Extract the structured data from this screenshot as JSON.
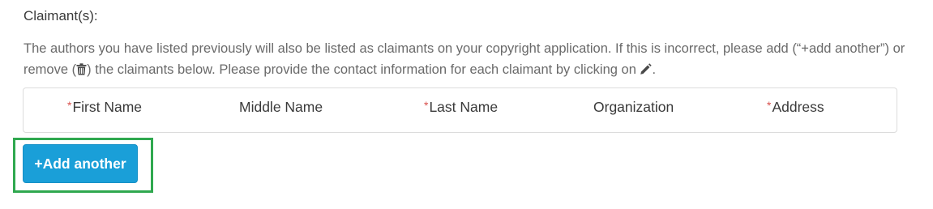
{
  "section": {
    "title": "Claimant(s):",
    "desc_part1": "The authors you have listed previously will also be listed as claimants on your copyright application. If this is incorrect, please add (“+add another”) or remove (",
    "desc_part2": ") the claimants below. Please provide the contact information for each claimant by clicking on ",
    "desc_part3": "."
  },
  "table": {
    "required_marker": "*",
    "columns": [
      {
        "label": "First Name",
        "required": true
      },
      {
        "label": "Middle Name",
        "required": false
      },
      {
        "label": "Last Name",
        "required": true
      },
      {
        "label": "Organization",
        "required": false
      },
      {
        "label": "Address",
        "required": true
      }
    ]
  },
  "actions": {
    "add_another_label": "+Add another"
  },
  "icons": {
    "remove": "trash-icon",
    "edit": "pencil-icon"
  },
  "colors": {
    "button_bg": "#1a9fd8",
    "highlight_border": "#2fa84f",
    "required": "#d9534f"
  }
}
